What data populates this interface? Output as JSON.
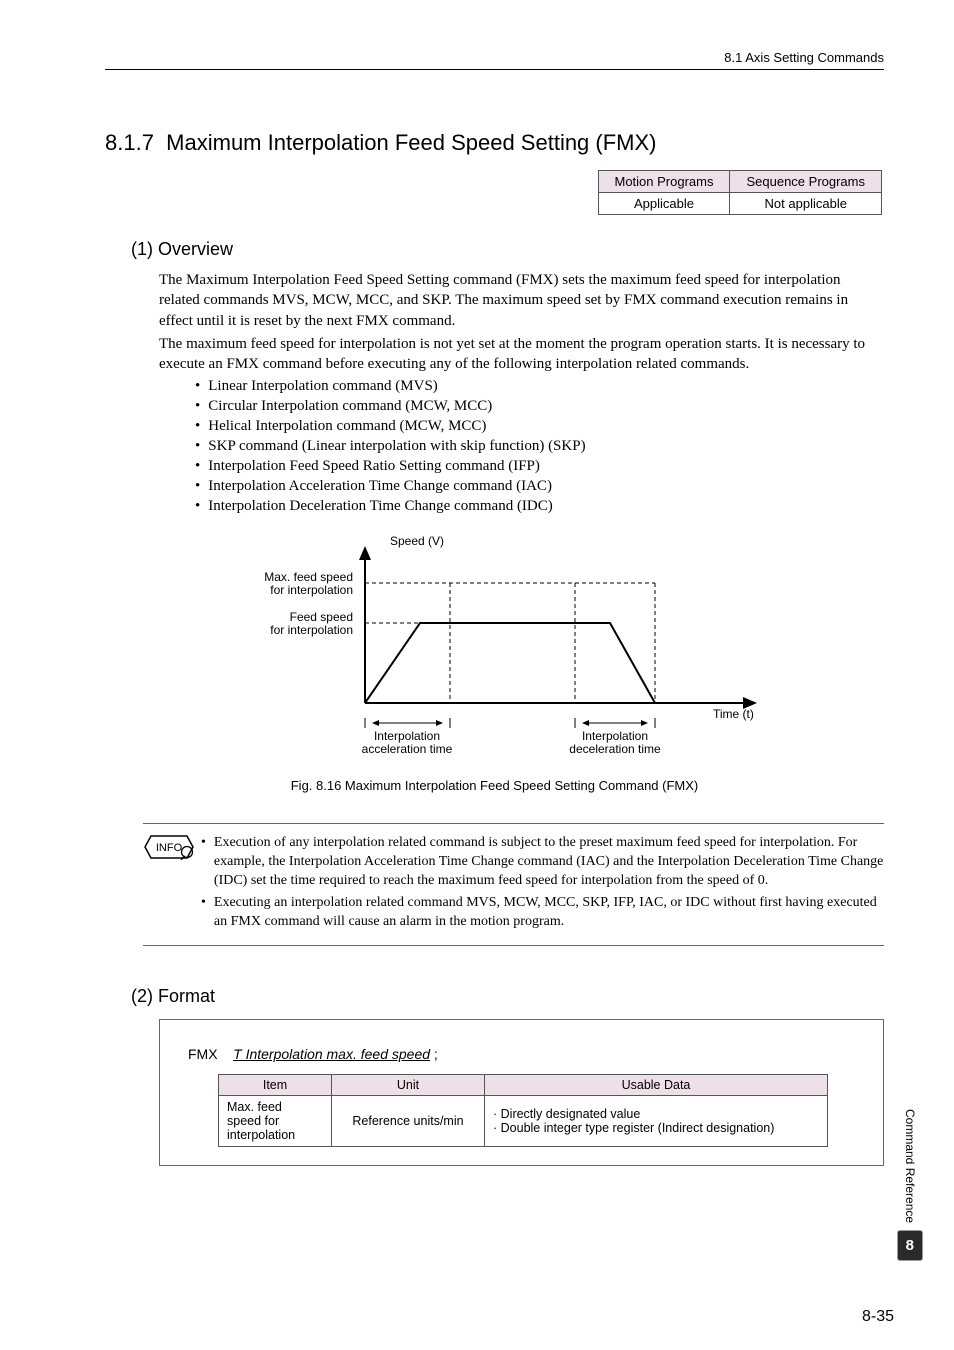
{
  "header": {
    "breadcrumb": "8.1 Axis Setting Commands"
  },
  "section": {
    "number": "8.1.7",
    "title": "Maximum Interpolation Feed Speed Setting (FMX)"
  },
  "appl_table": {
    "headers": [
      "Motion Programs",
      "Sequence Programs"
    ],
    "row": [
      "Applicable",
      "Not applicable"
    ]
  },
  "overview": {
    "heading": "(1) Overview",
    "para1": "The Maximum Interpolation Feed Speed Setting command (FMX) sets the maximum feed speed for interpolation related commands MVS, MCW, MCC, and SKP. The maximum speed set by FMX command execution remains in effect until it is reset by the next FMX command.",
    "para2": "The maximum feed speed for interpolation is not yet set at the moment the program operation starts. It is necessary to execute an FMX command before executing any of the following interpolation related commands.",
    "bullets": [
      "Linear Interpolation command (MVS)",
      "Circular Interpolation command (MCW, MCC)",
      "Helical Interpolation command (MCW, MCC)",
      "SKP command (Linear interpolation with skip function) (SKP)",
      "Interpolation Feed Speed Ratio Setting command (IFP)",
      "Interpolation Acceleration Time Change command (IAC)",
      "Interpolation Deceleration Time Change command (IDC)"
    ]
  },
  "figure": {
    "y_label": "Speed (V)",
    "x_label": "Time (t)",
    "max_label_l1": "Max. feed speed",
    "max_label_l2": "for interpolation",
    "feed_label_l1": "Feed speed",
    "feed_label_l2": "for interpolation",
    "acc_label_l1": "Interpolation",
    "acc_label_l2": "acceleration time",
    "dec_label_l1": "Interpolation",
    "dec_label_l2": "deceleration time",
    "caption": "Fig. 8.16  Maximum Interpolation Feed Speed Setting Command (FMX)"
  },
  "info": {
    "badge": "INFO",
    "items": [
      "Execution of any interpolation related command is subject to the preset maximum feed speed for interpolation. For example, the Interpolation Acceleration Time Change command (IAC) and the Interpolation Deceleration Time Change (IDC) set the time required to reach the maximum feed speed for interpolation from the speed of 0.",
      "Executing an interpolation related command MVS, MCW, MCC, SKP, IFP, IAC, or IDC without first having executed an FMX command will cause an alarm in the motion program."
    ]
  },
  "format": {
    "heading": "(2) Format",
    "cmd": "FMX",
    "param": "T Interpolation max. feed speed",
    "semi": " ;",
    "headers": [
      "Item",
      "Unit",
      "Usable Data"
    ],
    "row": {
      "item_l1": "Max. feed",
      "item_l2": "speed for",
      "item_l3": "interpolation",
      "unit": "Reference units/min",
      "data_l1": "· Directly designated value",
      "data_l2": "· Double integer type register (Indirect designation)"
    }
  },
  "side": {
    "label": "Command Reference",
    "chapter": "8"
  },
  "pagenum": "8-35",
  "chart_data": {
    "type": "line",
    "title": "Maximum Interpolation Feed Speed Setting Command (FMX)",
    "xlabel": "Time (t)",
    "ylabel": "Speed (V)",
    "x": [
      0,
      1,
      3,
      4
    ],
    "series": [
      {
        "name": "Feed speed for interpolation",
        "values": [
          0,
          0.6,
          0.6,
          0
        ]
      }
    ],
    "annotations": [
      {
        "type": "hline",
        "y": 1.0,
        "label": "Max. feed speed for interpolation"
      },
      {
        "type": "hline",
        "y": 0.6,
        "label": "Feed speed for interpolation"
      },
      {
        "type": "xrange",
        "from": 0,
        "to": 1,
        "label": "Interpolation acceleration time"
      },
      {
        "type": "xrange",
        "from": 3,
        "to": 4,
        "label": "Interpolation deceleration time"
      }
    ],
    "ylim": [
      0,
      1.2
    ],
    "xlim": [
      0,
      5
    ]
  }
}
